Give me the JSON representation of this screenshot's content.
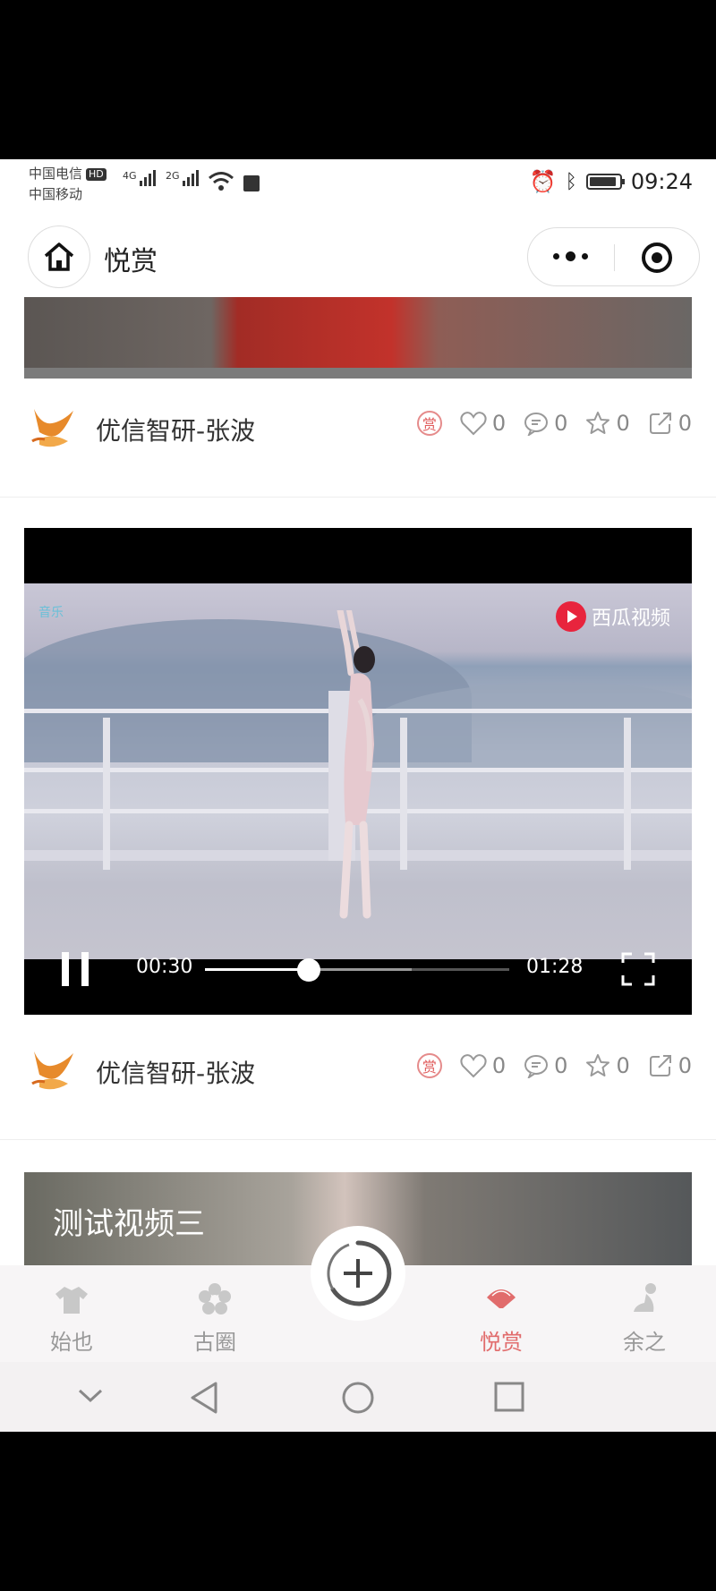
{
  "status_bar": {
    "carrier_1": "中国电信",
    "hd": "HD",
    "carrier_2": "中国移动",
    "net_1": "4G",
    "net_2": "2G",
    "time": "09:24",
    "battery_level": 0.9
  },
  "header": {
    "title": "悦赏",
    "home_icon": "home-icon",
    "menu_icon": "more-dots-icon",
    "close_icon": "target-icon"
  },
  "posts": [
    {
      "author": "优信智研-张波",
      "reward_label": "赏",
      "likes": "0",
      "comments": "0",
      "favorites": "0",
      "shares": "0"
    },
    {
      "author": "优信智研-张波",
      "reward_label": "赏",
      "likes": "0",
      "comments": "0",
      "favorites": "0",
      "shares": "0",
      "video": {
        "watermark": "西瓜视频",
        "corner_logo": "音乐",
        "current_time": "00:30",
        "duration": "01:28",
        "progress": 0.34,
        "buffered": 0.68
      }
    }
  ],
  "third_post": {
    "title": "测试视频三"
  },
  "tabbar": {
    "tabs": [
      {
        "label": "始也",
        "icon": "shirt-icon"
      },
      {
        "label": "古圈",
        "icon": "flower-icon"
      },
      {
        "label": "悦赏",
        "icon": "fan-icon",
        "active": true
      },
      {
        "label": "余之",
        "icon": "figure-icon"
      }
    ],
    "fab_icon": "plus-circle-icon"
  },
  "colors": {
    "accent": "#e16c6c",
    "inactive": "#999999"
  }
}
